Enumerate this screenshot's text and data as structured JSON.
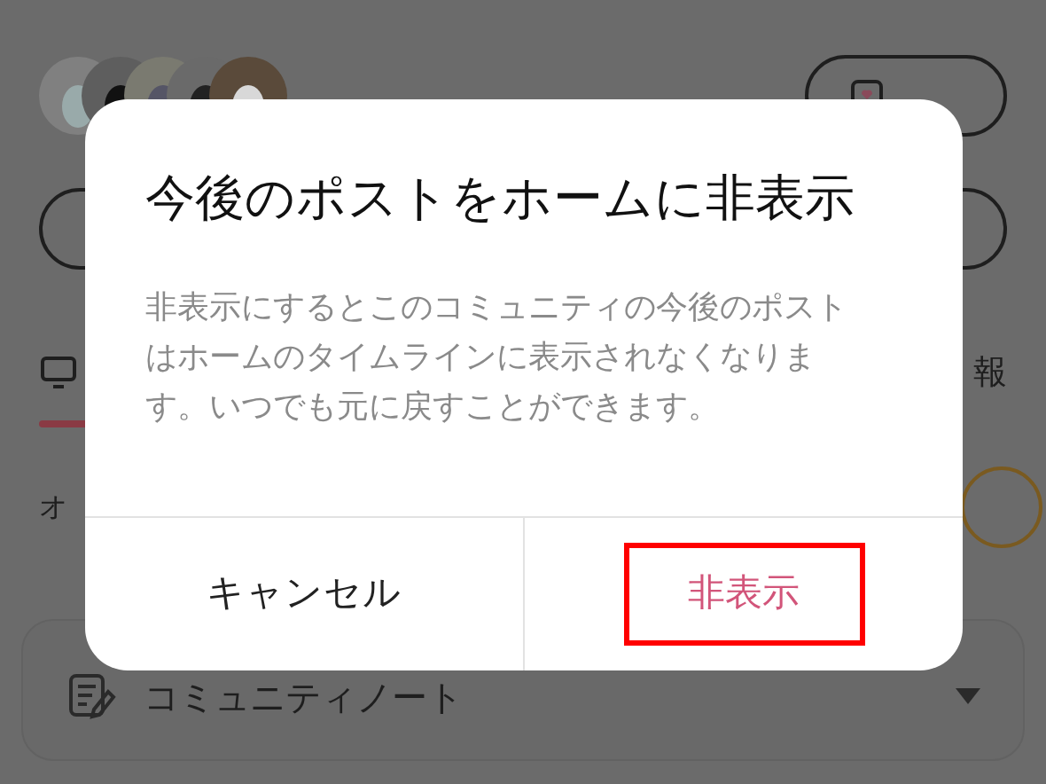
{
  "community": {
    "tab_fragment": "報",
    "section_fragment": "オ",
    "note_row": "コミュニティノート"
  },
  "dialog": {
    "title": "今後のポストをホームに非表示",
    "message": "非表示にするとこのコミュニティの今後のポストはホームのタイムラインに表示されなくなります。いつでも元に戻すことができます。",
    "buttons": [
      {
        "label": "キャンセル",
        "kind": "cancel",
        "highlighted": false
      },
      {
        "label": "非表示",
        "kind": "destructive",
        "highlighted": true
      }
    ]
  }
}
